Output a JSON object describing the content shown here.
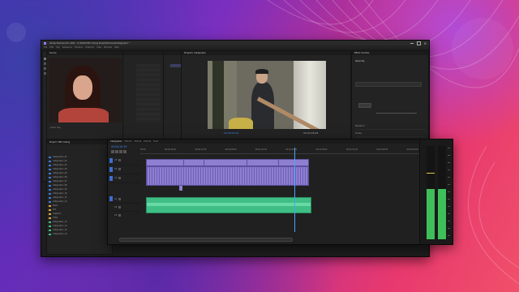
{
  "window": {
    "title": "Adobe Premiere Pro 2021 - D:\\2020\\VMC Calling Project\\Premiere\\Calligraphic *",
    "menu": [
      "File",
      "Edit",
      "Clip",
      "Sequence",
      "Markers",
      "Graphics",
      "View",
      "Window",
      "Help"
    ]
  },
  "source_panel": {
    "tab": "Source",
    "label": "Audio Clip"
  },
  "program_monitor": {
    "tab": "Program: Calligraphic",
    "timecode": "00;00;20;19",
    "duration": "00;02;48;28"
  },
  "effect_controls": {
    "tab": "Effect Controls",
    "fx": "Opacity",
    "rows": [
      "Position",
      "Scale",
      "Rotation",
      "Anchor Point",
      "Anti-flicker Filter",
      "Opacity",
      "Blend Mode",
      "Time Remapping"
    ]
  },
  "project_panel": {
    "tab": "Project: VMC Calling",
    "items": [
      "Calligraphic_01",
      "Calligraphic_02",
      "Calligraphic_03",
      "Calligraphic_04",
      "Calligraphic_05",
      "Calligraphic_06",
      "Calligraphic_07",
      "Calligraphic_08",
      "Calligraphic_09",
      "Calligraphic_10",
      "Calligraphic_11",
      "Calligraphic_12",
      "Music",
      "SFX",
      "Graphics",
      "Titles",
      "Calligraphic_13",
      "Calligraphic_14",
      "Calligraphic_15",
      "Calligraphic_16"
    ]
  },
  "timeline": {
    "tabs": [
      "Calligraphic",
      "Edit 01",
      "Edit 02",
      "Edit 03",
      "Final"
    ],
    "timecode": "00;00;20;19",
    "tracks": [
      "V3",
      "V2",
      "V1",
      "A1",
      "A2",
      "A3"
    ],
    "ruler": [
      "00;00",
      "00;00;16;00",
      "00;00;32;00",
      "00;00;48;00",
      "00;01;04;02",
      "00;01;20;02",
      "00;01;36;02",
      "00;01;52;02",
      "00;02;08;04",
      "00;02;24;04",
      "00;02;40;04"
    ]
  },
  "colors": {
    "video_clip": "#8f7fd0",
    "audio_clip": "#3fbf85",
    "meter": "#3fbf5a",
    "playhead": "#4aa3ff"
  }
}
